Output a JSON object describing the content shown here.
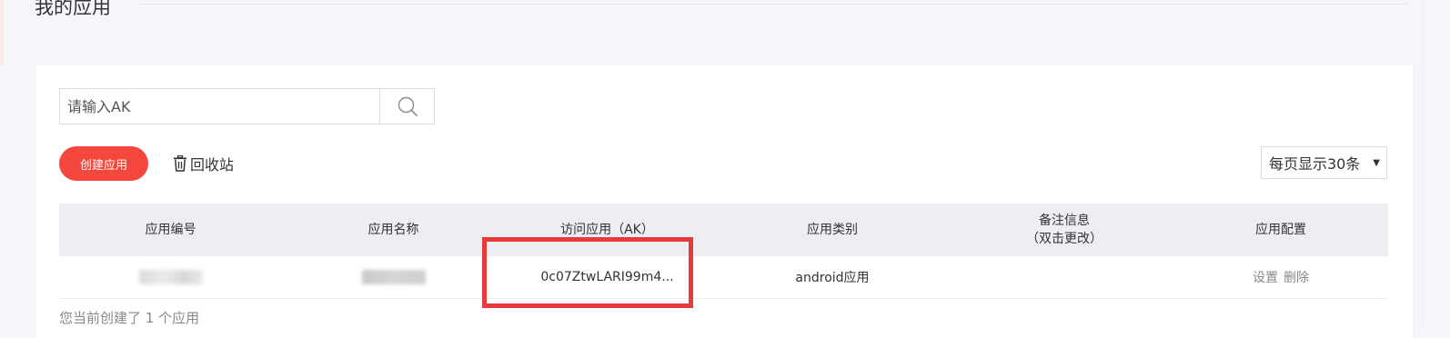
{
  "page": {
    "title": "我的应用"
  },
  "search": {
    "placeholder": "请输入AK",
    "button_icon": "search-icon"
  },
  "toolbar": {
    "create_label": "创建应用",
    "recycle_label": "回收站",
    "recycle_icon": "trash-icon"
  },
  "page_size": {
    "selected": "每页显示30条"
  },
  "table": {
    "columns": [
      "应用编号",
      "应用名称",
      "访问应用（AK）",
      "应用类别",
      "备注信息",
      "（双击更改）",
      "应用配置"
    ],
    "rows": [
      {
        "id": "",
        "name": "",
        "ak": "0c07ZtwLARI99m4...",
        "type": "android应用",
        "remark": "",
        "actions": [
          "设置",
          "删除"
        ]
      }
    ]
  },
  "footer": {
    "summary": "您当前创建了 1 个应用"
  },
  "colors": {
    "accent": "#f5473d",
    "highlight": "#e83a3a",
    "header_bg": "#eceef2",
    "page_bg": "#f5f6fa"
  }
}
